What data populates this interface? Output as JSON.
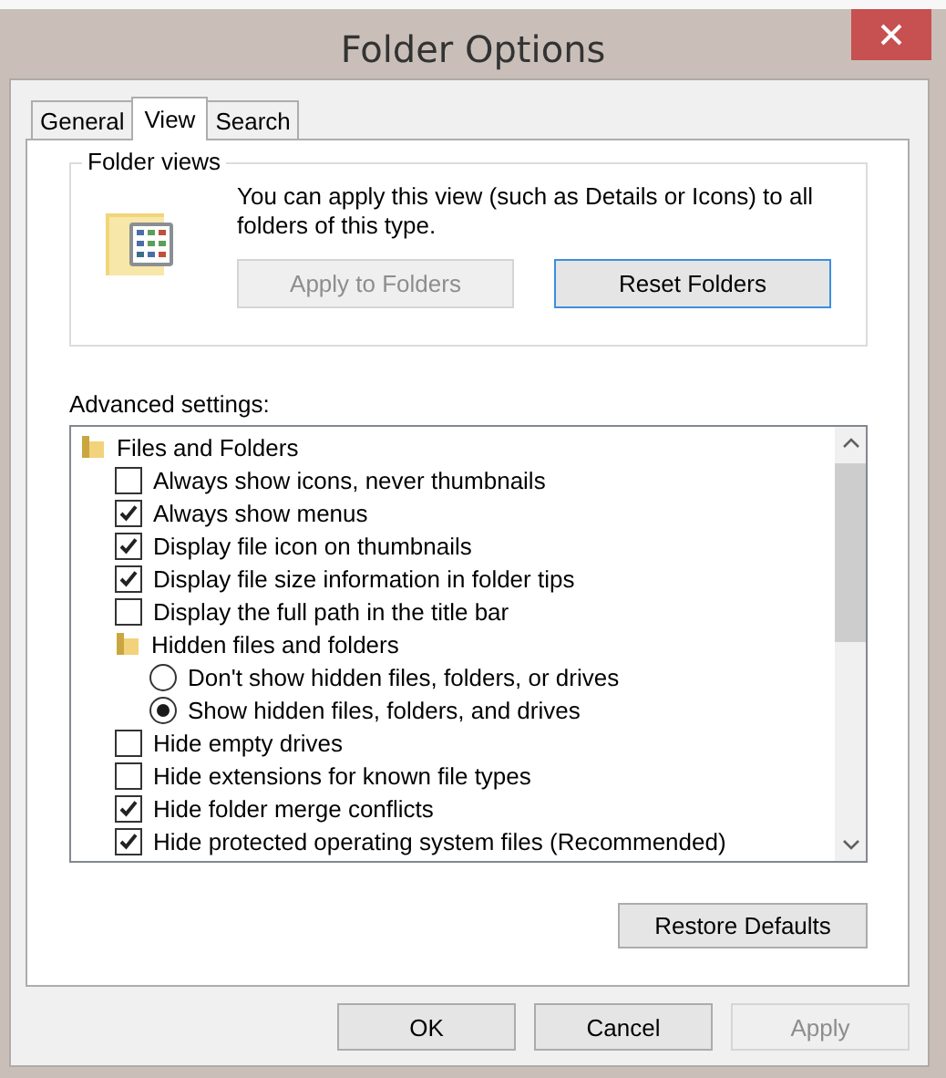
{
  "window": {
    "title": "Folder Options"
  },
  "tabs": [
    {
      "label": "General",
      "selected": false
    },
    {
      "label": "View",
      "selected": true
    },
    {
      "label": "Search",
      "selected": false
    }
  ],
  "folder_views": {
    "title": "Folder views",
    "description": "You can apply this view (such as Details or Icons) to all folders of this type.",
    "buttons": [
      {
        "label": "Apply to Folders",
        "disabled": true,
        "default": false
      },
      {
        "label": "Reset Folders",
        "disabled": false,
        "default": true
      }
    ]
  },
  "advanced_settings": {
    "label": "Advanced settings:",
    "items": [
      {
        "kind": "folder",
        "label": "Files and Folders",
        "children": [
          {
            "kind": "checkbox",
            "label": "Always show icons, never thumbnails",
            "checked": false
          },
          {
            "kind": "checkbox",
            "label": "Always show menus",
            "checked": true
          },
          {
            "kind": "checkbox",
            "label": "Display file icon on thumbnails",
            "checked": true
          },
          {
            "kind": "checkbox",
            "label": "Display file size information in folder tips",
            "checked": true
          },
          {
            "kind": "checkbox",
            "label": "Display the full path in the title bar",
            "checked": false
          },
          {
            "kind": "folder",
            "label": "Hidden files and folders",
            "children": [
              {
                "kind": "radio",
                "label": "Don't show hidden files, folders, or drives",
                "selected": false
              },
              {
                "kind": "radio",
                "label": "Show hidden files, folders, and drives",
                "selected": true
              }
            ]
          },
          {
            "kind": "checkbox",
            "label": "Hide empty drives",
            "checked": false
          },
          {
            "kind": "checkbox",
            "label": "Hide extensions for known file types",
            "checked": false
          },
          {
            "kind": "checkbox",
            "label": "Hide folder merge conflicts",
            "checked": true
          },
          {
            "kind": "checkbox",
            "label": "Hide protected operating system files (Recommended)",
            "checked": true
          }
        ]
      }
    ]
  },
  "restore_button": {
    "label": "Restore Defaults"
  },
  "buttons": [
    {
      "label": "OK",
      "disabled": false
    },
    {
      "label": "Cancel",
      "disabled": false
    },
    {
      "label": "Apply",
      "disabled": true
    }
  ]
}
